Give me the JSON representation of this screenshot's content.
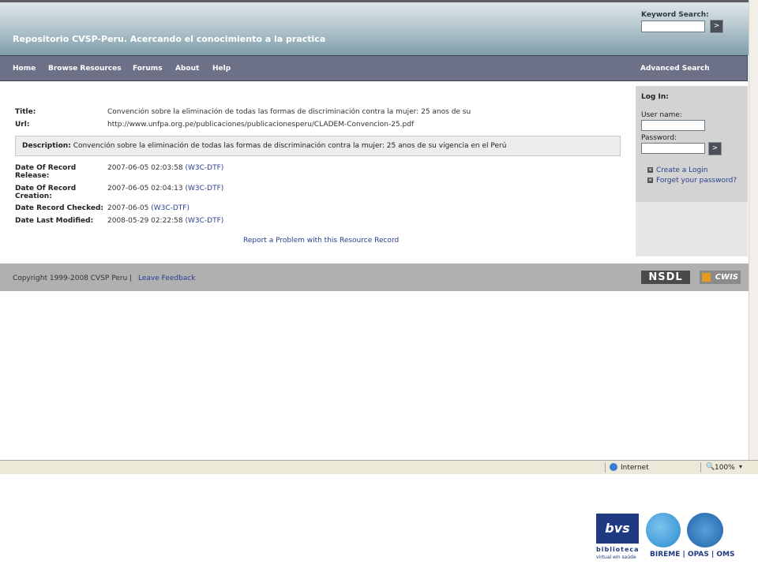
{
  "header": {
    "site_title": "Repositorio CVSP-Peru. Acercando el conocimiento a la practica",
    "keyword_search_label": "Keyword Search:",
    "go_symbol": ">"
  },
  "nav": {
    "items": [
      "Home",
      "Browse Resources",
      "Forums",
      "About",
      "Help"
    ],
    "advanced_search": "Advanced Search"
  },
  "record": {
    "title_label": "Title:",
    "title_value": "Convención sobre la eliminación de todas las formas de discriminación contra la mujer: 25 anos de su",
    "url_label": "Url:",
    "url_value": "http://www.unfpa.org.pe/publicaciones/publicacionesperu/CLADEM-Convencion-25.pdf",
    "description_label": "Description:",
    "description_value": "Convención sobre la eliminación de todas las formas de discriminación contra la mujer: 25 anos de su vigencia en el Perú",
    "release_label": "Date Of Record Release:",
    "release_value": "2007-06-05 02:03:58",
    "creation_label": "Date Of Record Creation:",
    "creation_value": "2007-06-05 02:04:13",
    "checked_label": "Date Record Checked:",
    "checked_value": "2007-06-05",
    "modified_label": "Date Last Modified:",
    "modified_value": "2008-05-29 02:22:58",
    "w3c_link": "(W3C-DTF)",
    "report_link": "Report a Problem with this Resource Record"
  },
  "login": {
    "title": "Log In:",
    "username_label": "User name:",
    "password_label": "Password:",
    "go_symbol": ">",
    "create_login": "Create a Login",
    "forgot_password": "Forget your password?"
  },
  "footer": {
    "copyright": "Copyright 1999-2008 CVSP Peru  |",
    "feedback": "Leave Feedback",
    "nsdl_logo": "NSDL",
    "cwis_logo": "CWIS"
  },
  "statusbar": {
    "zone": "Internet",
    "zoom": "100%"
  },
  "slide_logos": {
    "bvs_mark": "bvs",
    "bvs_name": "biblioteca",
    "bvs_sub": "virtual em saúde",
    "orgs": "BIREME | OPAS | OMS"
  },
  "colors": {
    "navbar": "#6d7187",
    "link": "#2a3f8f",
    "footer": "#b0b0b0",
    "login_panel": "#d3d3d3"
  }
}
